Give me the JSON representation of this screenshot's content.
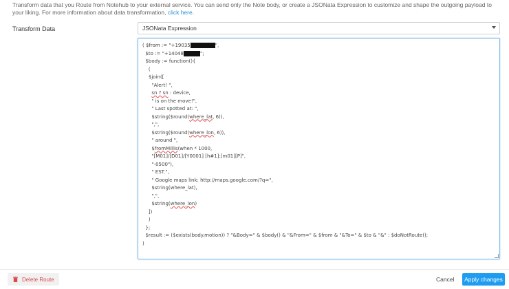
{
  "intro": {
    "text": "Transform data that you Route from Notehub to your external service. You can send only the Note body, or create a JSONata Expression to customize and shape the outgoing payload to your liking. For more information about data transformation, ",
    "link": "click here."
  },
  "transform": {
    "label": "Transform Data",
    "selected": "JSONata Expression"
  },
  "code": {
    "lines": [
      "( $from := \"+19035",
      "  $to := \"+14048",
      "  $body := function(){",
      "    (",
      "    $join([",
      "      \"Alert! \",",
      "      ",
      "      \" is on the move!\",",
      "      \" Last spotted at: \",",
      "      $string($round(",
      "      \",\",",
      "      $string($round(",
      "      \" around \",",
      "      $",
      "      \"[M01]/[D01]/[Y0001] [h#1]:[m01][P]\",",
      "      \"-0500\"),",
      "      \" EST.\",",
      "      \" Google maps link: http://maps.google.com/?q=\",",
      "      $string(where_lat),",
      "      \",\",",
      "      $string(",
      "    ])",
      "    )",
      "  };",
      "  $result := ($exists(body.motion)) ? \"&Body=\" & $body() & \"&From=\" & $from & \"&To=\" & $to & \"&\" : $doNotRoute();",
      ")"
    ],
    "fragments": {
      "from_end": "\",",
      "to_end": "\";",
      "sn_line_pre": "sn ? sn",
      "sn_line_post": " : device,",
      "lat_mid": "where_lat",
      "lat_end": ", 6)),",
      "lon_mid": "where_lon",
      "lon_end": ", 6)),",
      "millis_fn": "fromMillis",
      "millis_args": "(when * 1000,",
      "lon_final": "where_lon",
      "lon_final_end": ")"
    }
  },
  "footer": {
    "delete_label": "Delete Route",
    "cancel_label": "Cancel",
    "apply_label": "Apply changes"
  },
  "colors": {
    "accent": "#1e9df0",
    "danger": "#d94b4b",
    "link": "#2d8fd6"
  }
}
